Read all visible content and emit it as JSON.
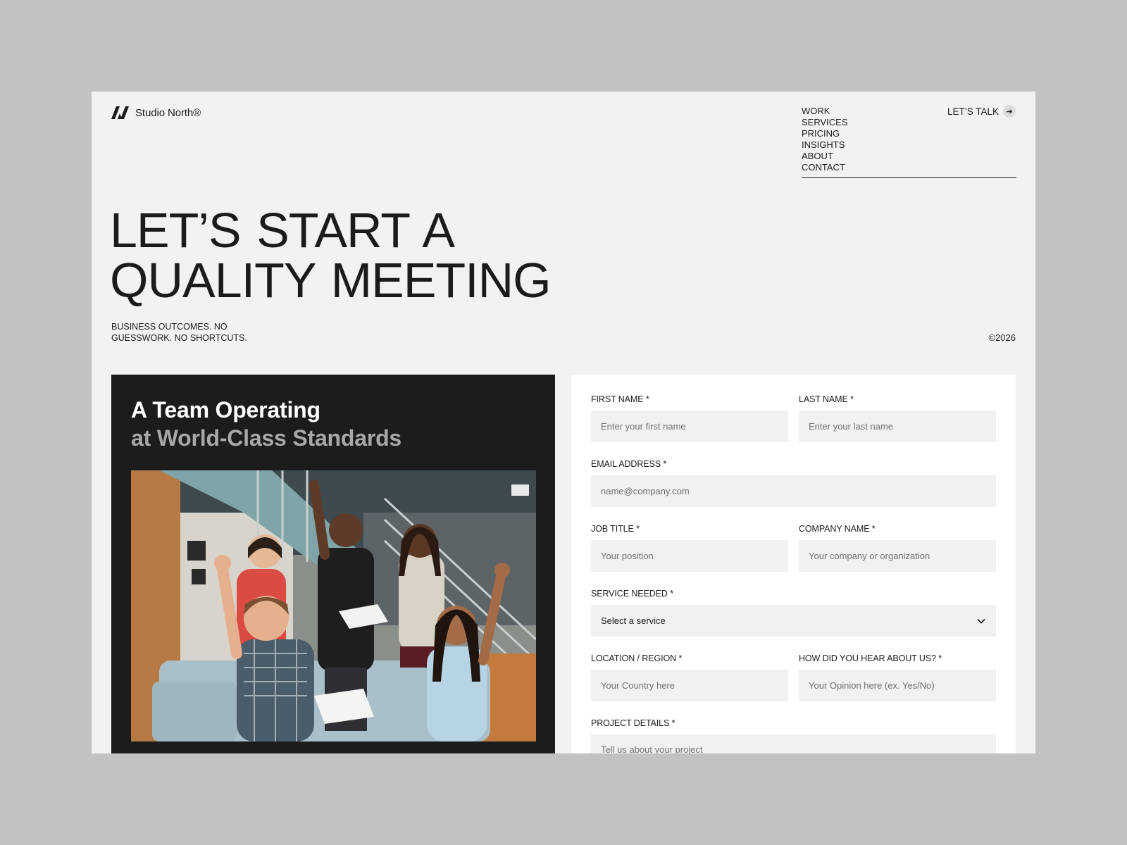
{
  "brand": {
    "name": "Studio North®"
  },
  "nav": {
    "items": [
      "WORK",
      "SERVICES",
      "PRICING",
      "INSIGHTS",
      "ABOUT",
      "CONTACT"
    ]
  },
  "cta": {
    "label": "LET’S TALK",
    "icon": "arrow-right-icon"
  },
  "hero": {
    "title": "LET’S START A\nQUALITY  MEETING",
    "tagline": "BUSINESS OUTCOMES. NO GUESSWORK. NO SHORTCUTS.",
    "copyright": "©2026"
  },
  "team": {
    "title": "A Team Operating",
    "subtitle": "at World-Class Standards"
  },
  "form": {
    "first_name": {
      "label": "FIRST NAME *",
      "placeholder": "Enter your first name"
    },
    "last_name": {
      "label": "LAST NAME *",
      "placeholder": "Enter your last name"
    },
    "email": {
      "label": "EMAIL ADDRESS *",
      "placeholder": "name@company.com"
    },
    "job_title": {
      "label": "JOB TITLE *",
      "placeholder": "Your position"
    },
    "company": {
      "label": "COMPANY NAME *",
      "placeholder": "Your company or organization"
    },
    "service": {
      "label": "SERVICE NEEDED *",
      "value": "Select a service"
    },
    "location": {
      "label": "LOCATION / REGION *",
      "placeholder": "Your Country here"
    },
    "referral": {
      "label": "HOW DID YOU HEAR ABOUT US? *",
      "placeholder": "Your Opinion here (ex. Yes/No)"
    },
    "project": {
      "label": "PROJECT DETAILS *",
      "placeholder": "Tell us about your project"
    }
  },
  "colors": {
    "page_bg": "#c2c2c2",
    "surface": "#f2f2f2",
    "dark": "#1c1c1c",
    "input_bg": "#f1f1f1"
  }
}
